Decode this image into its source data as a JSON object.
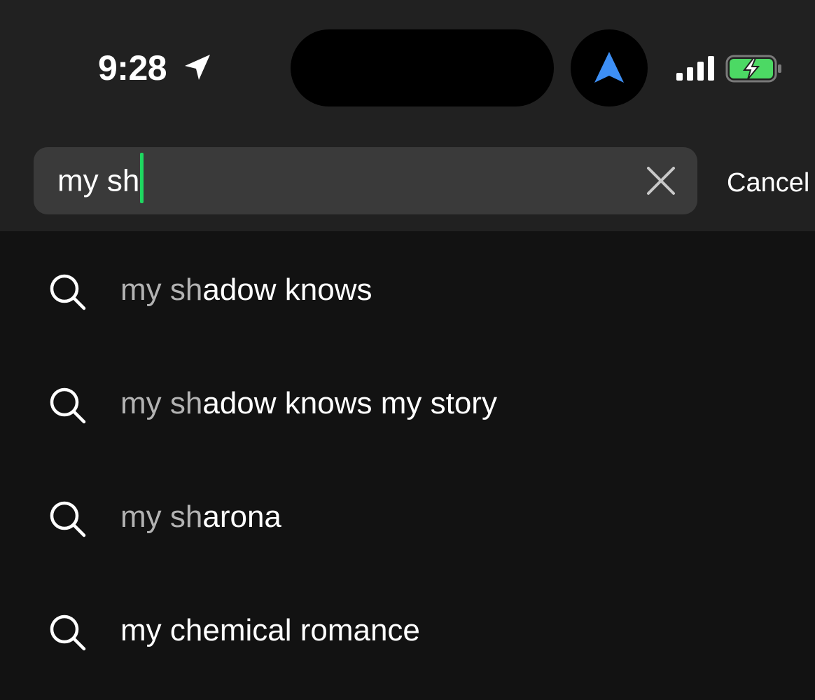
{
  "status_bar": {
    "time": "9:28",
    "icons": [
      "location-arrow-icon",
      "navigation-icon",
      "cellular-signal-icon",
      "battery-charging-icon"
    ]
  },
  "search": {
    "value": "my sh",
    "clear_icon": "close-icon",
    "cancel_label": "Cancel"
  },
  "suggestions": [
    {
      "match": "my sh",
      "rest": "adow knows",
      "icon": "search-icon"
    },
    {
      "match": "my sh",
      "rest": "adow knows my story",
      "icon": "search-icon"
    },
    {
      "match": "my sh",
      "rest": "arona",
      "icon": "search-icon"
    },
    {
      "match": "",
      "rest": "my chemical romance",
      "icon": "search-icon"
    }
  ],
  "colors": {
    "background": "#121212",
    "header": "#212121",
    "field": "#3a3a3a",
    "caret": "#1ed760",
    "match_text": "#b3b3b3",
    "nav_arrow": "#3d8ff5",
    "battery_fill": "#4cd964"
  }
}
